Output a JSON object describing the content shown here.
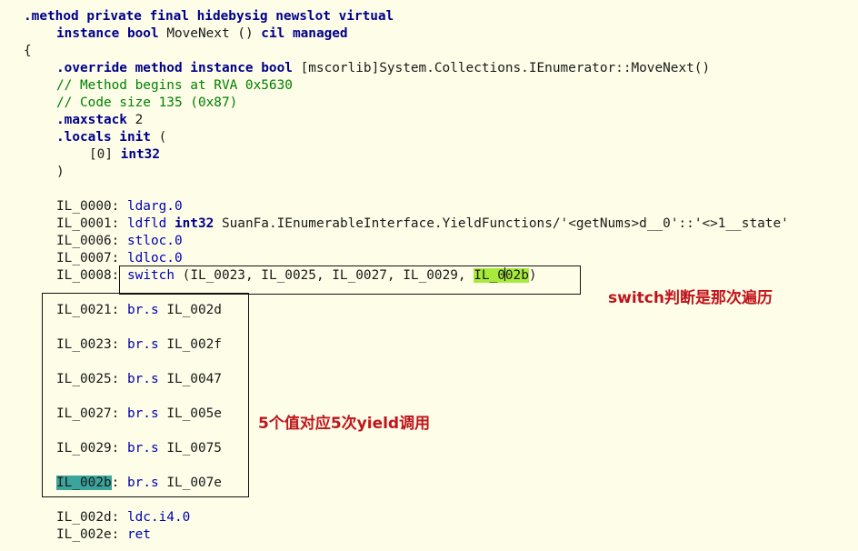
{
  "header": {
    "method_kw": ".method",
    "modifiers": "private final hidebysig newslot virtual",
    "instance_kw": "instance",
    "bool_kw": "bool",
    "method_name": "MoveNext ()",
    "cil_managed": "cil managed",
    "open_brace": "{",
    "override_kw": ".override method instance bool",
    "override_target": "[mscorlib]System.Collections.IEnumerator::MoveNext()",
    "comment_rva": "// Method begins at RVA 0x5630",
    "comment_size": "// Code size 135 (0x87)",
    "maxstack_kw": ".maxstack",
    "maxstack_val": "2",
    "locals_kw": ".locals init",
    "locals_open": "(",
    "local0_idx": "[0]",
    "local0_type": "int32",
    "locals_close": ")"
  },
  "instructions": [
    {
      "label": "IL_0000:",
      "op": "ldarg.0"
    },
    {
      "label": "IL_0001:",
      "op": "ldfld",
      "type": "int32",
      "operand": "SuanFa.IEnumerableInterface.YieldFunctions/'<getNums>d__0'::'<>1__state'"
    },
    {
      "label": "IL_0006:",
      "op": "stloc.0"
    },
    {
      "label": "IL_0007:",
      "op": "ldloc.0"
    },
    {
      "label": "IL_0008",
      "colon": ":",
      "op": "switch",
      "operand_pre": "(IL_0023, IL_0025, IL_0027, IL_0029,",
      "operand_hl_a": "IL_0",
      "operand_hl_b": "02b",
      "operand_post": ")"
    }
  ],
  "branches": [
    {
      "label": "IL_0021:",
      "op": "br.s",
      "target": "IL_002d"
    },
    {
      "label": "IL_0023:",
      "op": "br.s",
      "target": "IL_002f"
    },
    {
      "label": "IL_0025:",
      "op": "br.s",
      "target": "IL_0047"
    },
    {
      "label": "IL_0027:",
      "op": "br.s",
      "target": "IL_005e"
    },
    {
      "label": "IL_0029:",
      "op": "br.s",
      "target": "IL_0075"
    },
    {
      "label": "IL_002b",
      "colon": ":",
      "op": "br.s",
      "target": "IL_007e"
    }
  ],
  "tail": [
    {
      "label": "IL_002d:",
      "op": "ldc.i4.0"
    },
    {
      "label": "IL_002e:",
      "op": "ret"
    }
  ],
  "annotations": {
    "switch_note": "switch判断是那次遍历",
    "yield_note": "5个值对应5次yield调用"
  },
  "colors": {
    "background": "#fdfde8",
    "keyword": "#00008b",
    "comment": "#008000",
    "annotation": "#c0141c",
    "highlight_green": "#a8ea3c",
    "highlight_teal": "#3aa59c"
  }
}
